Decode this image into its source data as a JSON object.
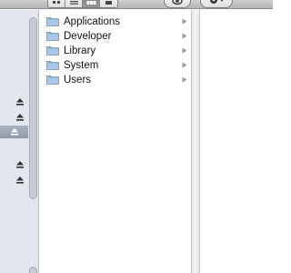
{
  "toolbar": {
    "view_modes": [
      {
        "icon": "icon-view-icon",
        "active": false
      },
      {
        "icon": "list-view-icon",
        "active": false
      },
      {
        "icon": "column-view-icon",
        "active": true
      },
      {
        "icon": "coverflow-view-icon",
        "active": false
      }
    ],
    "quicklook_icon": "eye-icon",
    "action_icon": "gear-icon"
  },
  "sidebar": {
    "eject_icons": [
      {
        "icon": "eject-icon",
        "selected": false
      },
      {
        "icon": "eject-icon",
        "selected": false
      },
      {
        "icon": "eject-icon",
        "selected": true
      },
      {
        "icon": "eject-icon",
        "selected": false
      },
      {
        "icon": "eject-icon",
        "selected": false
      }
    ]
  },
  "column1": {
    "items": [
      {
        "label": "Applications",
        "icon": "folder-icon"
      },
      {
        "label": "Developer",
        "icon": "folder-icon"
      },
      {
        "label": "Library",
        "icon": "folder-icon"
      },
      {
        "label": "System",
        "icon": "folder-icon"
      },
      {
        "label": "Users",
        "icon": "folder-icon"
      }
    ]
  },
  "colors": {
    "folder": "#8fb3d9",
    "sidebar_bg": "#e2e7ed",
    "selection": "#9aa5b4"
  }
}
